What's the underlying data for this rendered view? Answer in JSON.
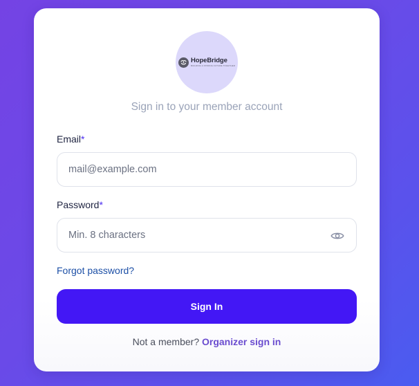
{
  "brand": {
    "name": "HopeBridge",
    "tagline": "BUILDING A STRONG FUTURE TOGETHER",
    "accent_color": "#4317f5",
    "logo_icon": "hopebridge-logo-icon"
  },
  "subtitle": "Sign in to your member account",
  "form": {
    "email": {
      "label": "Email",
      "required_marker": "*",
      "value": "",
      "placeholder": "mail@example.com"
    },
    "password": {
      "label": "Password",
      "required_marker": "*",
      "value": "",
      "placeholder": "Min. 8 characters",
      "toggle_icon": "eye-icon"
    },
    "forgot_link": "Forgot password?",
    "submit_label": "Sign In"
  },
  "footer": {
    "prompt": "Not a member?",
    "link": "Organizer sign in"
  }
}
